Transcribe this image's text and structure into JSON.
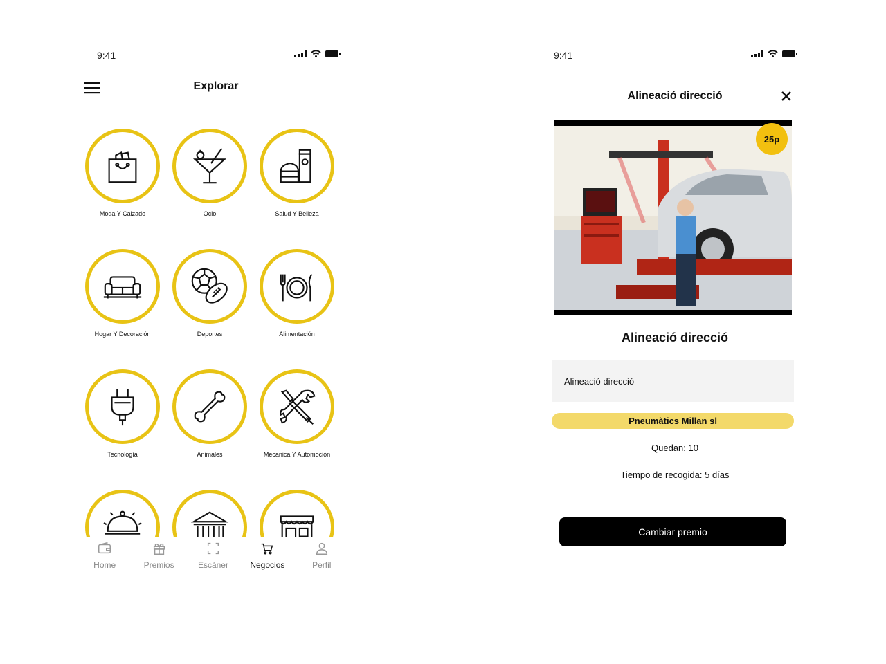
{
  "status_bar": {
    "time": "9:41"
  },
  "explore": {
    "title": "Explorar",
    "categories": [
      {
        "label": "Moda Y Calzado",
        "icon": "shopping-bag-icon"
      },
      {
        "label": "Ocio",
        "icon": "cocktail-icon"
      },
      {
        "label": "Salud Y Belleza",
        "icon": "cosmetics-icon"
      },
      {
        "label": "Hogar Y Decoración",
        "icon": "sofa-icon"
      },
      {
        "label": "Deportes",
        "icon": "sports-balls-icon"
      },
      {
        "label": "Alimentación",
        "icon": "plate-cutlery-icon"
      },
      {
        "label": "Tecnología",
        "icon": "plug-icon"
      },
      {
        "label": "Animales",
        "icon": "bone-icon"
      },
      {
        "label": "Mecanica Y Automoción",
        "icon": "wrench-screwdriver-icon"
      },
      {
        "label": "",
        "icon": "cloche-icon"
      },
      {
        "label": "",
        "icon": "museum-icon"
      },
      {
        "label": "",
        "icon": "storefront-icon"
      }
    ],
    "tabs": [
      {
        "label": "Home",
        "icon": "wallet-icon",
        "active": false
      },
      {
        "label": "Premios",
        "icon": "gift-icon",
        "active": false
      },
      {
        "label": "Escáner",
        "icon": "scan-icon",
        "active": false
      },
      {
        "label": "Negocios",
        "icon": "cart-icon",
        "active": true
      },
      {
        "label": "Perfil",
        "icon": "user-icon",
        "active": false
      }
    ],
    "accent_color": "#e8c315"
  },
  "detail": {
    "header_title": "Alineació direcció",
    "points_badge": "25p",
    "title": "Alineació direcció",
    "description": "Alineació direcció",
    "shop_name": "Pneumàtics Millan sl",
    "remaining": "Quedan: 10",
    "pickup_time": "Tiempo de recogida: 5 días",
    "cta_label": "Cambiar premio",
    "badge_color": "#f2c00f",
    "pill_color": "#f3d96a"
  }
}
